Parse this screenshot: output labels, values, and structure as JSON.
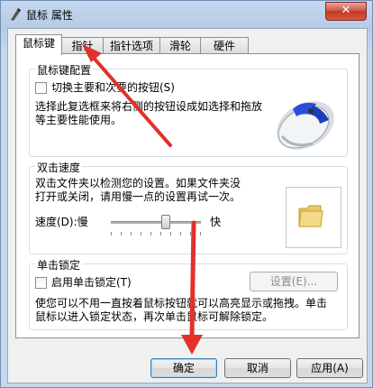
{
  "window": {
    "title": "鼠标 属性",
    "close_glyph": "✕"
  },
  "tabs": [
    "鼠标键",
    "指针",
    "指针选项",
    "滑轮",
    "硬件"
  ],
  "buttons_config": {
    "group_title": "鼠标键配置",
    "checkbox_label": "切换主要和次要的按钮(S)",
    "description_line1": "选择此复选框来将右侧的按钮设成如选择和拖放",
    "description_line2": "等主要性能使用。"
  },
  "double_click": {
    "group_title": "双击速度",
    "description_line1": "双击文件夹以检测您的设置。如果文件夹没",
    "description_line2": "打开或关闭，请用慢一点的设置再试一次。",
    "speed_label": "速度(D):慢",
    "fast_label": "快",
    "speed_level": 0.6
  },
  "click_lock": {
    "group_title": "单击锁定",
    "checkbox_label": "启用单击锁定(T)",
    "settings_button": "设置(E)...",
    "description_line1": "使您可以不用一直按着鼠标按钮就可以高亮显示或拖拽。单击",
    "description_line2": "鼠标以进入锁定状态，再次单击鼠标可解除锁定。"
  },
  "footer": {
    "ok": "确定",
    "cancel": "取消",
    "apply": "应用(A)"
  },
  "colors": {
    "annotation_arrow": "#e2312b"
  }
}
